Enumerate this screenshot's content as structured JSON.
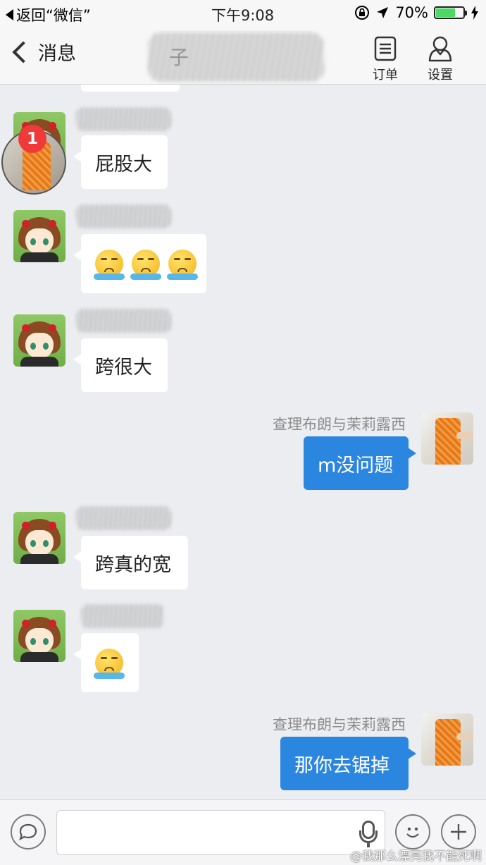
{
  "status_bar": {
    "back_app": "返回“微信”",
    "time": "下午9:08",
    "battery": "70%",
    "battery_level": 0.7
  },
  "nav": {
    "back_label": "消息",
    "title": "子",
    "actions": [
      {
        "label": "订单",
        "icon": "document-icon"
      },
      {
        "label": "设置",
        "icon": "person-icon"
      }
    ]
  },
  "chat": {
    "messages": [
      {
        "side": "in",
        "text": "屁股大",
        "badge": "1"
      },
      {
        "side": "in",
        "emoji_count": 3,
        "emoji": "crying-emoji"
      },
      {
        "side": "in",
        "text": "跨很大"
      },
      {
        "side": "out",
        "sender": "查理布朗与茉莉露西",
        "text": "m没问题"
      },
      {
        "side": "in",
        "text": "跨真的宽"
      },
      {
        "side": "in",
        "emoji_count": 1,
        "emoji": "crying-emoji"
      },
      {
        "side": "out",
        "sender": "查理布朗与茉莉露西",
        "text": "那你去锯掉"
      }
    ]
  },
  "input_bar": {
    "placeholder": "",
    "watermark": "@我那么漂亮我不能死啊"
  }
}
